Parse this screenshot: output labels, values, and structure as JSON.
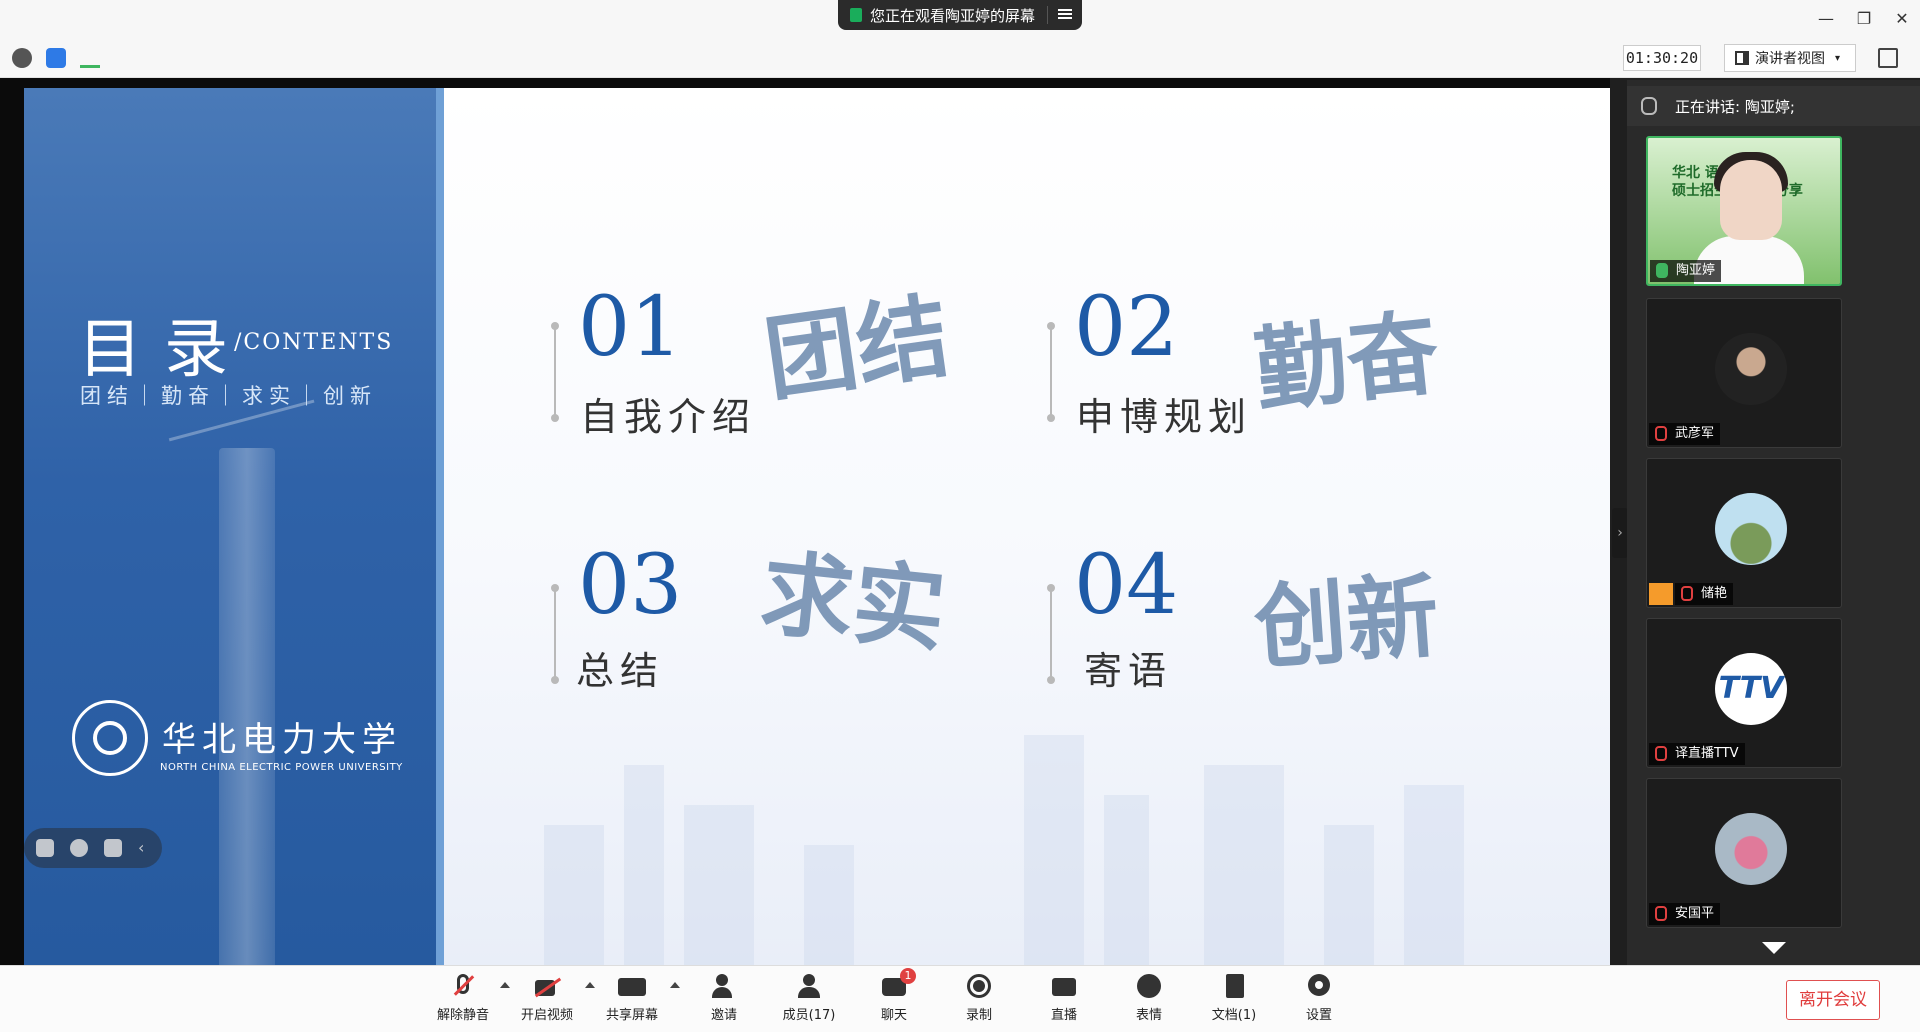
{
  "window": {
    "share_banner": "您正在观看陶亚婷的屏幕",
    "minimize": "—",
    "restore": "❐",
    "close": "✕"
  },
  "toolbar": {
    "timer": "01:30:20",
    "view_mode": "演讲者视图"
  },
  "slide": {
    "toc_title": "目录",
    "toc_sub": "/CONTENTS",
    "motto": "团结｜勤奋｜求实｜创新",
    "university_cn": "华北电力大学",
    "university_en": "NORTH CHINA ELECTRIC POWER UNIVERSITY",
    "items": [
      {
        "num": "01",
        "label": "自我介绍",
        "calligraphy": "团结"
      },
      {
        "num": "02",
        "label": "申博规划",
        "calligraphy": "勤奋"
      },
      {
        "num": "03",
        "label": "总结",
        "calligraphy": "求实"
      },
      {
        "num": "04",
        "label": "寄语",
        "calligraphy": "创新"
      }
    ]
  },
  "sidebar": {
    "speaking": "正在讲话: 陶亚婷;",
    "preview_text": "华北 语系\n硕士招生 研经验分享",
    "participants": [
      {
        "name": "陶亚婷",
        "muted": false
      },
      {
        "name": "武彦军",
        "muted": true
      },
      {
        "name": "储艳",
        "muted": true
      },
      {
        "name": "译直播TTV",
        "muted": true
      },
      {
        "name": "安国平",
        "muted": true
      }
    ],
    "ttv_logo": "TTV"
  },
  "controls": {
    "unmute": "解除静音",
    "video": "开启视频",
    "share": "共享屏幕",
    "invite": "邀请",
    "members": "成员(17)",
    "chat": "聊天",
    "chat_badge": "1",
    "record": "录制",
    "live": "直播",
    "emoji": "表情",
    "docs": "文档(1)",
    "settings": "设置",
    "leave": "离开会议"
  },
  "colors": {
    "accent_blue": "#1e5aa6",
    "leave_red": "#e03c3c",
    "active_green": "#3fb660"
  }
}
